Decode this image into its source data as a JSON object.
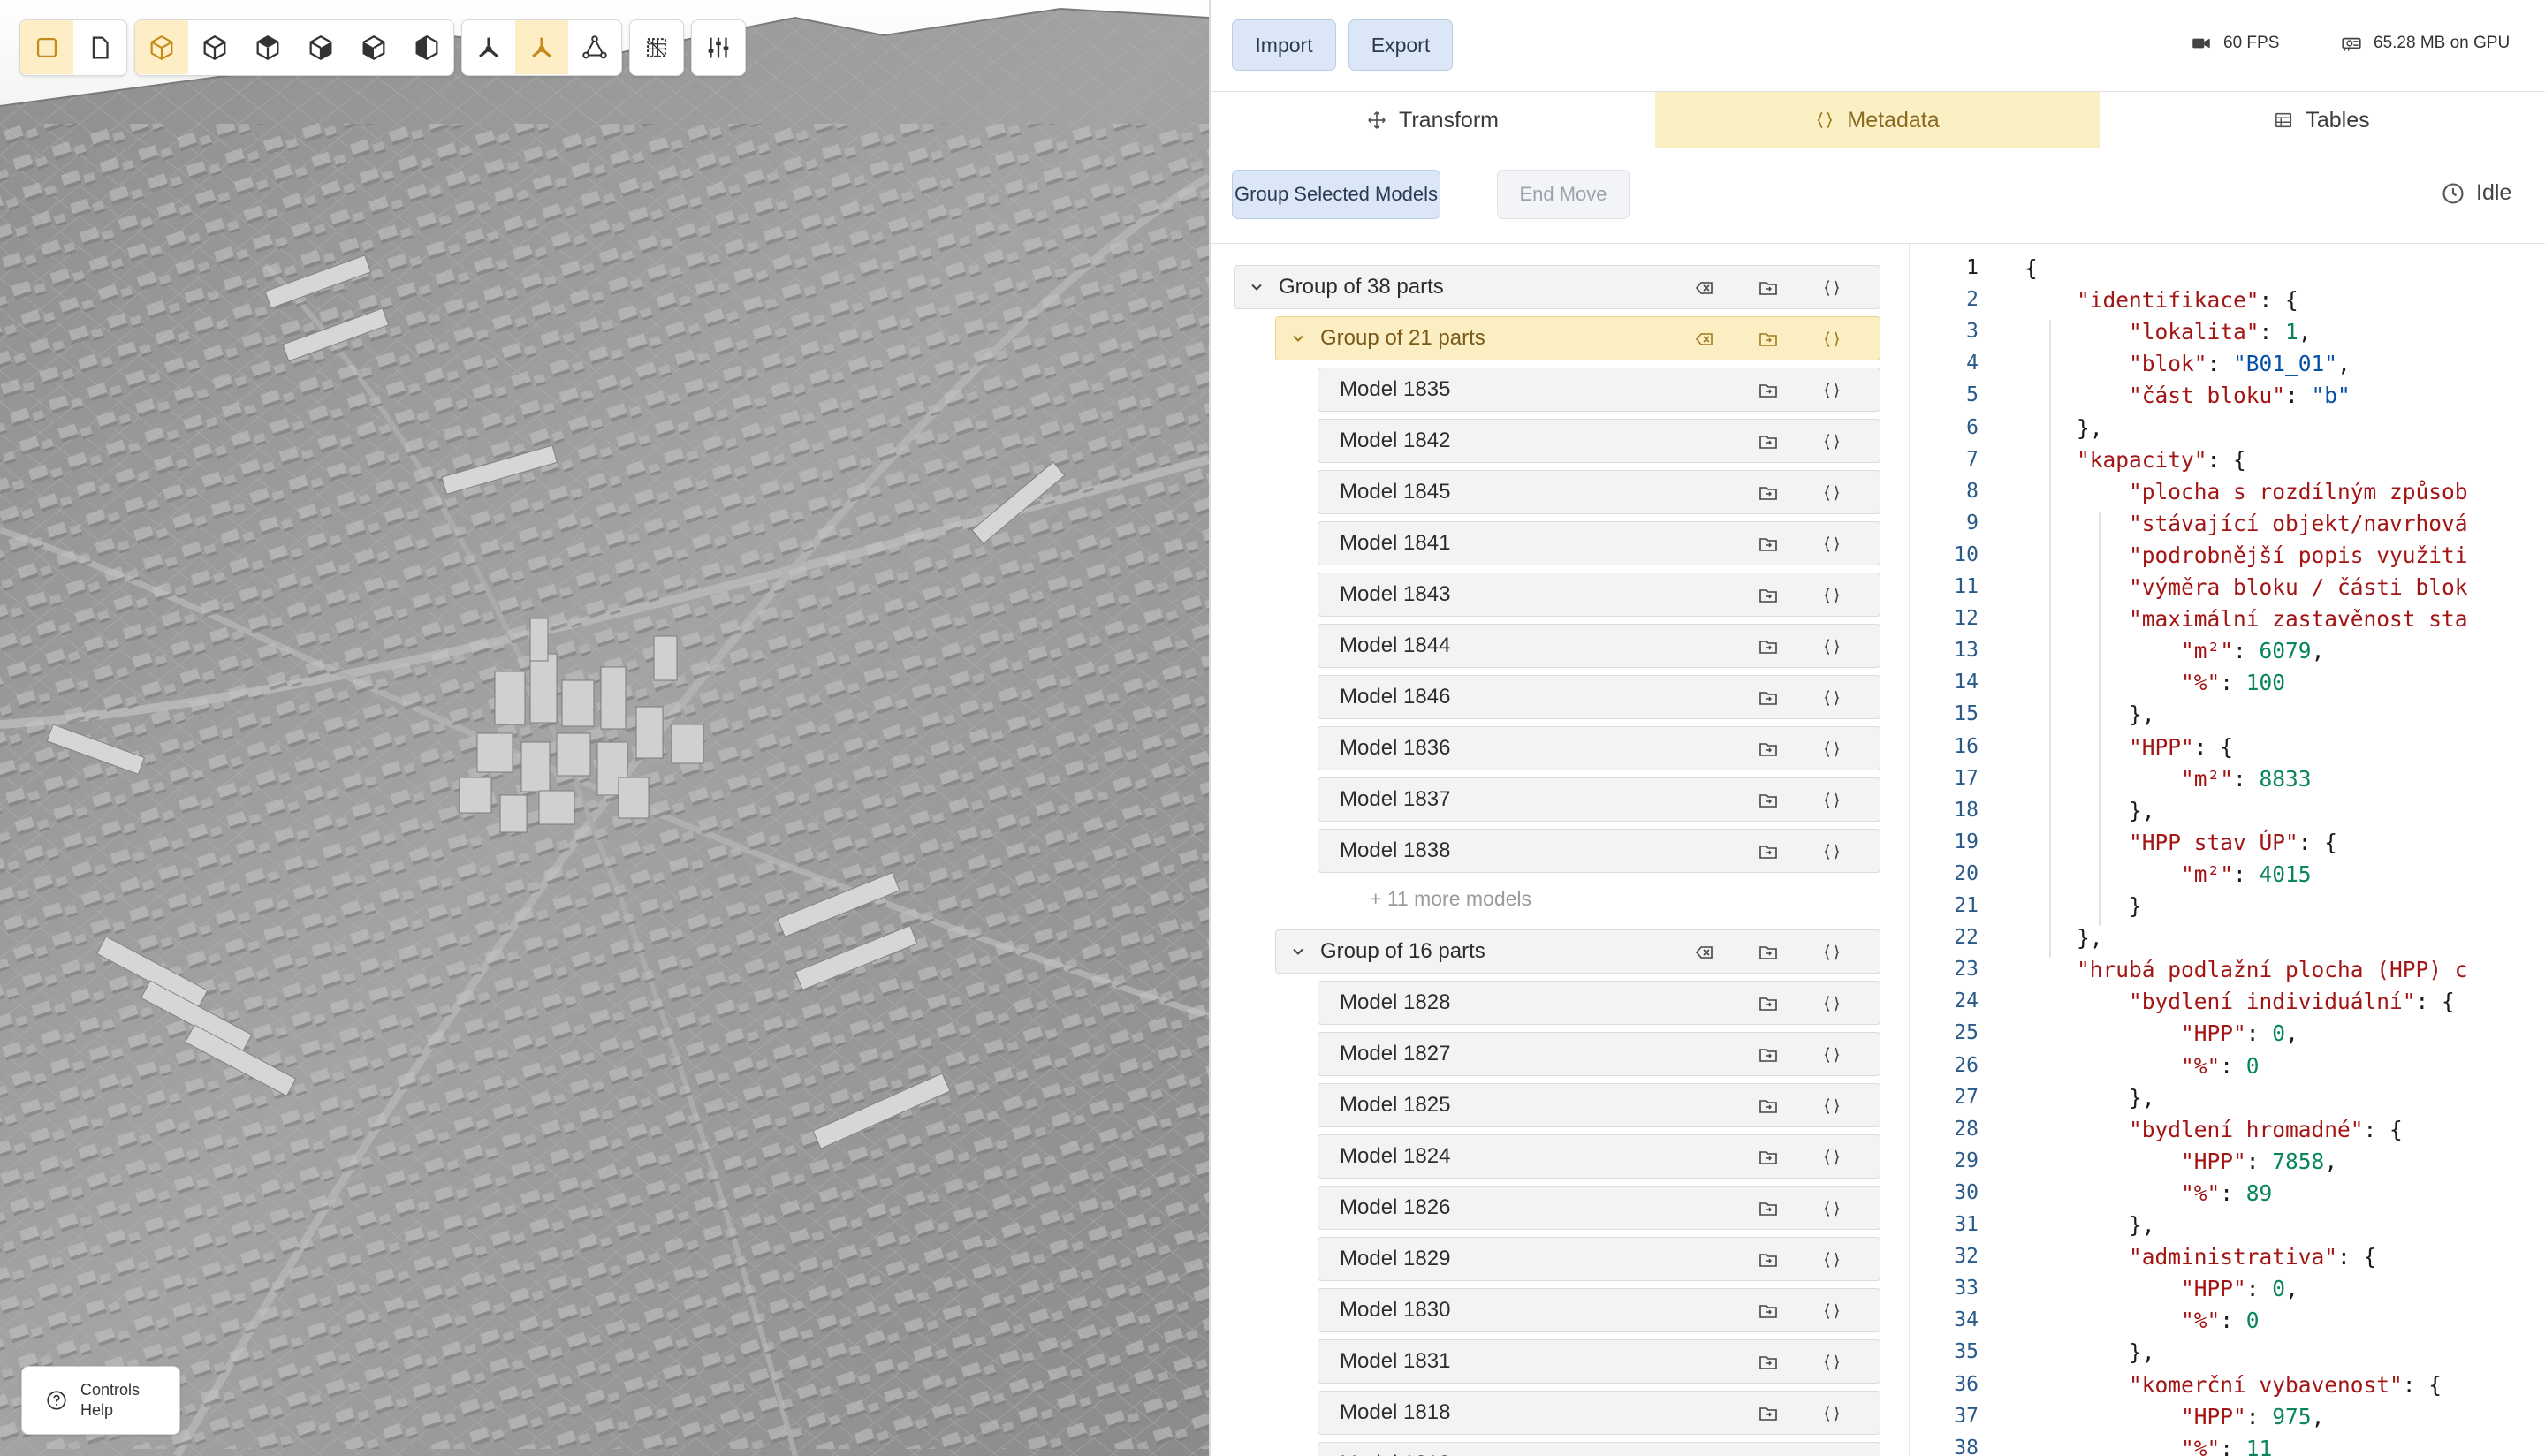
{
  "toolbar": {
    "groups": [
      [
        "square-icon",
        "page-icon"
      ],
      [
        "cube-wireframe-icon",
        "cube-icon",
        "cube-shaded-icon",
        "cube-solid-icon",
        "cube-half-icon",
        "cube-split-icon"
      ],
      [
        "axis-icon",
        "axis-active-icon",
        "nodes-icon"
      ],
      [
        "select-grid-icon"
      ],
      [
        "sliders-icon"
      ]
    ],
    "active": [
      "square-icon",
      "cube-wireframe-icon",
      "axis-active-icon"
    ]
  },
  "controls_help": {
    "line1": "Controls",
    "line2": "Help"
  },
  "topbar": {
    "import_label": "Import",
    "export_label": "Export",
    "fps": "60 FPS",
    "gpu": "65.28 MB on GPU"
  },
  "tabs": [
    {
      "label": "Transform",
      "icon": "move-icon"
    },
    {
      "label": "Metadata",
      "icon": "braces-icon"
    },
    {
      "label": "Tables",
      "icon": "table-icon"
    }
  ],
  "actions": {
    "group_selected": "Group Selected Models",
    "end_move": "End Move",
    "status": "Idle"
  },
  "tree": {
    "root": {
      "label": "Group of 38 parts"
    },
    "group1": {
      "label": "Group of 21 parts",
      "models": [
        "Model 1835",
        "Model 1842",
        "Model 1845",
        "Model 1841",
        "Model 1843",
        "Model 1844",
        "Model 1846",
        "Model 1836",
        "Model 1837",
        "Model 1838"
      ],
      "more": "+ 11 more models"
    },
    "group2": {
      "label": "Group of 16 parts",
      "models": [
        "Model 1828",
        "Model 1827",
        "Model 1825",
        "Model 1824",
        "Model 1826",
        "Model 1829",
        "Model 1830",
        "Model 1831",
        "Model 1818"
      ]
    }
  },
  "editor": {
    "current_line": 1,
    "lines": [
      "{",
      "    \"identifikace\": {",
      "        \"lokalita\": 1,",
      "        \"blok\": \"B01_01\",",
      "        \"část bloku\": \"b\"",
      "    },",
      "    \"kapacity\": {",
      "        \"plocha s rozdílným způsob",
      "        \"stávající objekt/navrhová",
      "        \"podrobnější popis využiti",
      "        \"výměra bloku / části blok",
      "        \"maximální zastavěnost sta",
      "            \"m²\": 6079,",
      "            \"%\": 100",
      "        },",
      "        \"HPP\": {",
      "            \"m²\": 8833",
      "        },",
      "        \"HPP stav ÚP\": {",
      "            \"m²\": 4015",
      "        }",
      "    },",
      "    \"hrubá podlažní plocha (HPP) c",
      "        \"bydlení individuální\": {",
      "            \"HPP\": 0,",
      "            \"%\": 0",
      "        },",
      "        \"bydlení hromadné\": {",
      "            \"HPP\": 7858,",
      "            \"%\": 89",
      "        },",
      "        \"administrativa\": {",
      "            \"HPP\": 0,",
      "            \"%\": 0",
      "        },",
      "        \"komerční vybavenost\": {",
      "            \"HPP\": 975,",
      "            \"%\": 11"
    ]
  }
}
